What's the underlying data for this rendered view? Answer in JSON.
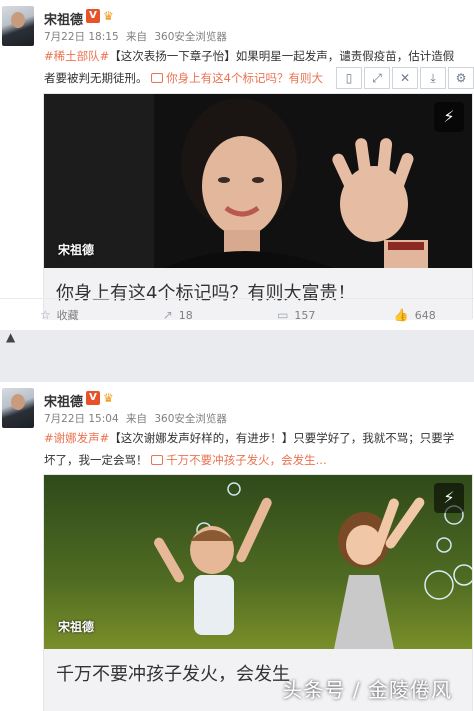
{
  "posts": [
    {
      "user": {
        "name": "宋祖德",
        "vip_mark": "V"
      },
      "meta": {
        "date": "7月22日 18:15",
        "source_prefix": "来自",
        "source": "360安全浏览器"
      },
      "text": {
        "line1_tag": "#稀土部队#",
        "line1": "【这次表扬一下章子怡】如果明星一起发声，谴责假疫苗，估计造假",
        "line2": "者要被判无期徒刑。",
        "link": "你身上有这4个标记吗？有则大"
      },
      "card": {
        "caption": "你身上有这4个标记吗？有则大富贵！",
        "image_name": "宋祖德"
      },
      "actions": {
        "favorite": "收藏",
        "repost": "18",
        "comment": "157",
        "like": "648"
      }
    },
    {
      "user": {
        "name": "宋祖德",
        "vip_mark": "V"
      },
      "meta": {
        "date": "7月22日 15:04",
        "source_prefix": "来自",
        "source": "360安全浏览器"
      },
      "text": {
        "line1_tag": "#谢娜发声#",
        "line1": "【这次谢娜发声好样的，有进步！】只要学好了，我就不骂；只要学",
        "line2": "坏了，我一定会骂！",
        "link": "千万不要冲孩子发火，会发生..."
      },
      "card": {
        "caption": "千万不要冲孩子发火，会发生",
        "image_name": "宋祖德"
      }
    }
  ],
  "watermark": "头条号 / 金陵倦风",
  "icons": {
    "play": "lightning-icon",
    "repost": "repost-icon",
    "comment": "comment-icon",
    "like": "thumb-up-icon",
    "favorite": "star-icon"
  },
  "colors": {
    "topic": "#eb7350",
    "vip": "#e6532b",
    "muted": "#808080"
  }
}
